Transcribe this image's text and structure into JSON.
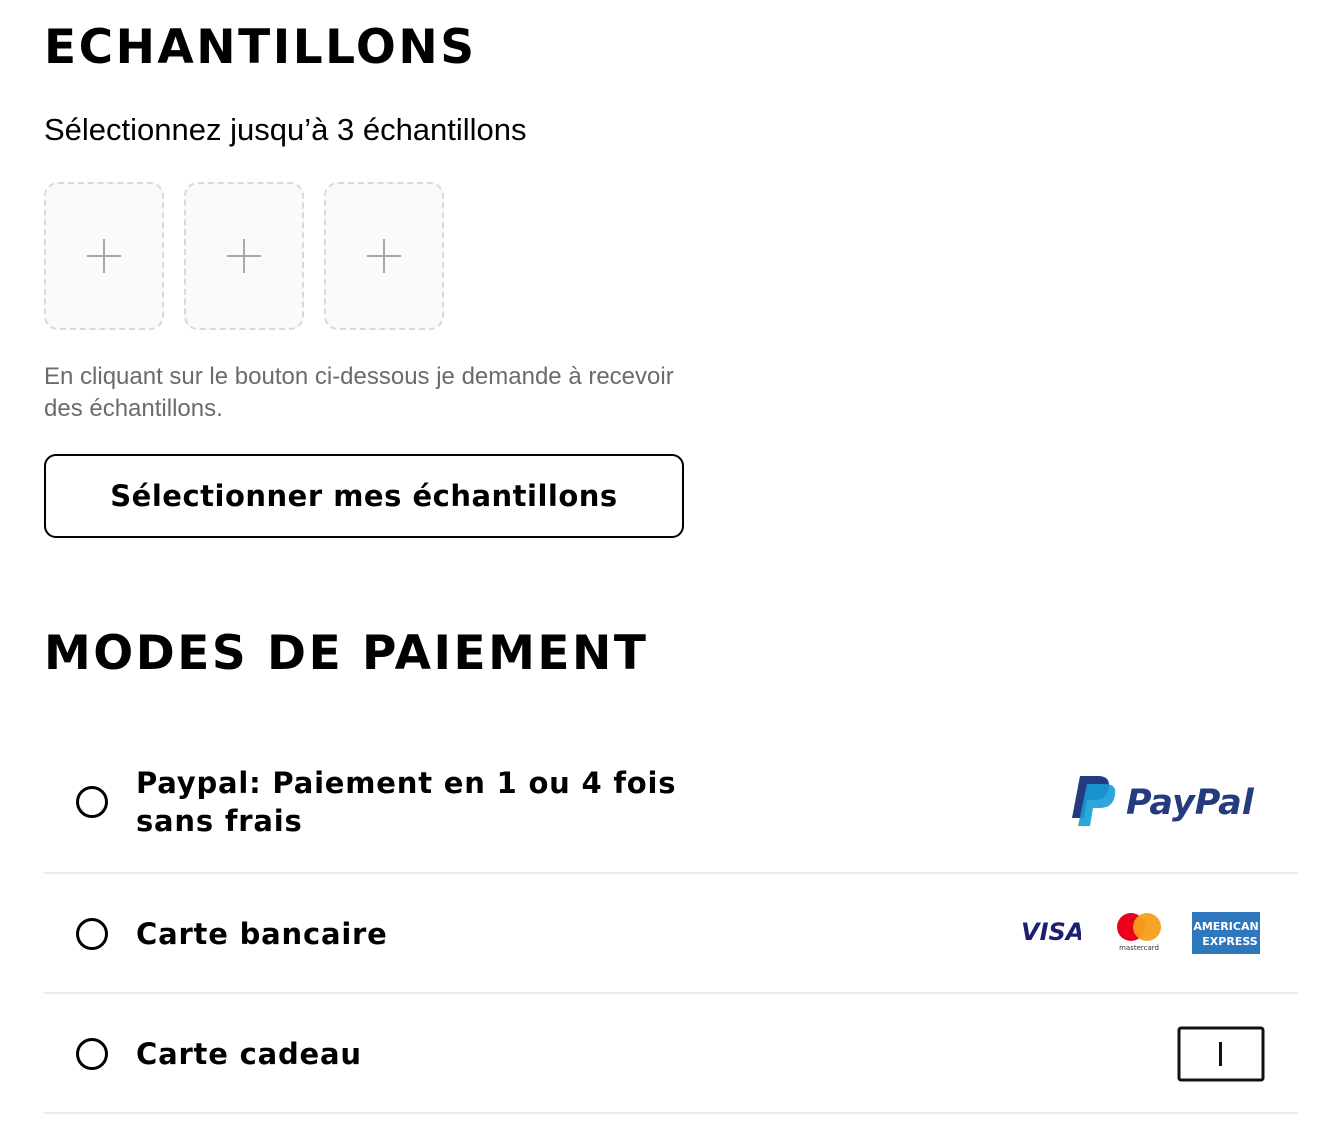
{
  "samples": {
    "title": "ECHANTILLONS",
    "subtitle": "Sélectionnez jusqu’à 3 échantillons",
    "slots": [
      {
        "icon": "plus-icon"
      },
      {
        "icon": "plus-icon"
      },
      {
        "icon": "plus-icon"
      }
    ],
    "disclaimer": "En cliquant sur le bouton ci-dessous je demande à recevoir des échantillons.",
    "button_label": "Sélectionner mes échantillons"
  },
  "payment": {
    "title": "MODES DE PAIEMENT",
    "options": [
      {
        "label": "Paypal: Paiement en 1 ou 4 fois sans frais",
        "selected": false,
        "logos": [
          "paypal-logo"
        ],
        "logo_text": {
          "paypal": "PayPal"
        }
      },
      {
        "label": "Carte bancaire",
        "selected": false,
        "logos": [
          "visa-logo",
          "mastercard-logo",
          "amex-logo"
        ],
        "logo_text": {
          "visa": "VISA",
          "mastercard": "mastercard",
          "amex_1": "AMERICAN",
          "amex_2": "EXPRESS"
        }
      },
      {
        "label": "Carte cadeau",
        "selected": false,
        "logos": [
          "gift-card-icon"
        ]
      }
    ]
  },
  "colors": {
    "text": "#000000",
    "muted_text": "#6b6b6b",
    "slot_border": "#d9d9d9",
    "slot_bg": "#fafafa",
    "divider": "#ececec",
    "paypal_dark": "#253b80",
    "paypal_light": "#179bd7",
    "visa_blue": "#1a1f71",
    "mc_red": "#eb001b",
    "mc_orange": "#f79e1b",
    "amex_blue": "#2e77bc"
  }
}
